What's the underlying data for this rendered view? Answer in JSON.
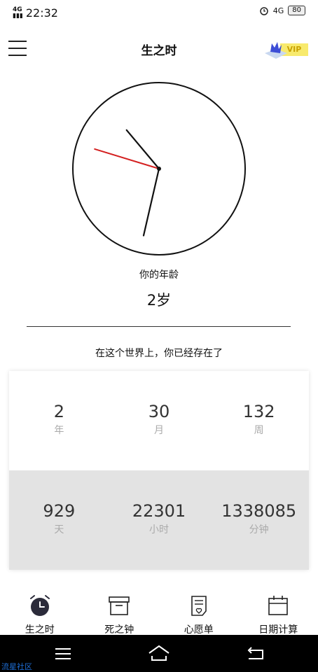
{
  "status_bar": {
    "signal": "4G",
    "time": "22:32",
    "network_right": "4G",
    "battery": "80"
  },
  "header": {
    "title": "生之时",
    "vip_label": "VIP"
  },
  "clock": {
    "hour_hand_angle_deg": -40,
    "minute_hand_angle_deg": 193,
    "second_hand_angle_deg": -73
  },
  "age": {
    "label": "你的年龄",
    "value": "2岁"
  },
  "existence": {
    "label": "在这个世界上，你已经存在了",
    "top_row": [
      {
        "value": "2",
        "unit": "年"
      },
      {
        "value": "30",
        "unit": "月"
      },
      {
        "value": "132",
        "unit": "周"
      }
    ],
    "bottom_row": [
      {
        "value": "929",
        "unit": "天"
      },
      {
        "value": "22301",
        "unit": "小时"
      },
      {
        "value": "1338085",
        "unit": "分钟"
      }
    ]
  },
  "tabs": [
    {
      "label": "生之时",
      "icon": "alarm-clock-icon",
      "active": true
    },
    {
      "label": "死之钟",
      "icon": "archive-box-icon",
      "active": false
    },
    {
      "label": "心愿单",
      "icon": "wish-list-icon",
      "active": false
    },
    {
      "label": "日期计算",
      "icon": "calendar-icon",
      "active": false
    }
  ],
  "nav_bar": {
    "buttons": [
      "menu",
      "home",
      "back"
    ]
  },
  "watermark": "流星社区",
  "colors": {
    "second_hand": "#d42020",
    "stats_bottom_bg": "#e3e3e3",
    "vip_tag": "#f8ea6d"
  }
}
